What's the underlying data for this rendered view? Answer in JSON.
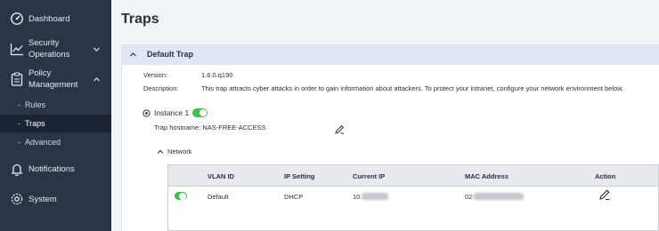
{
  "sidebar": {
    "items": [
      {
        "label_line1": "Dashboard",
        "label_line2": ""
      },
      {
        "label_line1": "Security",
        "label_line2": "Operations"
      },
      {
        "label_line1": "Policy",
        "label_line2": "Management"
      },
      {
        "label_line1": "Notifications",
        "label_line2": ""
      },
      {
        "label_line1": "System",
        "label_line2": ""
      }
    ],
    "subitems": [
      {
        "bullet": "-",
        "label": "Rules"
      },
      {
        "bullet": "-",
        "label": "Traps"
      },
      {
        "bullet": "-",
        "label": "Advanced"
      }
    ],
    "icons": [
      "dashboard-icon",
      "chart-icon",
      "clipboard-icon",
      "bell-icon",
      "gear-icon"
    ]
  },
  "main": {
    "title": "Traps",
    "card": {
      "title": "Default Trap",
      "version_label": "Version:",
      "version_value": "1.6.0.q190",
      "description_label": "Description:",
      "description_value": "This trap attracts cyber attacks in order to gain information about attackers. To protect your intranet, configure your network environment below.",
      "instance_label": "Instance 1",
      "instance_enabled": true,
      "hostname_text": "Trap hostname: NAS-FREE-ACCESS",
      "network_label": "Network",
      "table": {
        "headers": [
          "VLAN ID",
          "IP Setting",
          "Current IP",
          "MAC Address",
          "Action"
        ],
        "rows": [
          {
            "enabled": true,
            "vlan": "Default",
            "ip_setting": "DHCP",
            "current_ip_prefix": "10.",
            "mac_prefix": "02:"
          }
        ]
      }
    }
  },
  "colors": {
    "sidebar_bg": "#2a3548",
    "sidebar_active_bg": "#1b2434",
    "card_header_bg": "#dfe6f1",
    "toggle_on": "#3fbf4c"
  }
}
